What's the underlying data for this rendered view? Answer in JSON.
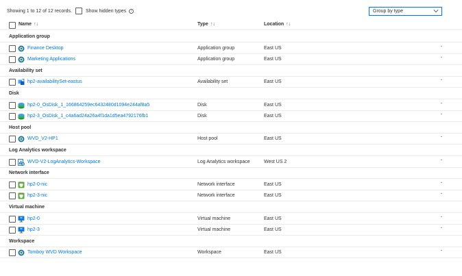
{
  "toolbar": {
    "records_text": "Showing 1 to 12 of 12 records.",
    "show_hidden_label": "Show hidden types",
    "info_glyph": "i",
    "group_by_value": "Group by type"
  },
  "table": {
    "columns": {
      "name": "Name",
      "name_sort": "↑↓",
      "type": "Type",
      "type_sort": "↑↓",
      "location": "Location",
      "location_sort": "↑↓"
    },
    "groups": [
      {
        "label": "Application group",
        "items": [
          {
            "name": "Finance Desktop",
            "type": "Application group",
            "location": "East US",
            "icon": "application-group-icon"
          },
          {
            "name": "Marketing Applications",
            "type": "Application group",
            "location": "East US",
            "icon": "application-group-icon"
          }
        ]
      },
      {
        "label": "Availability set",
        "items": [
          {
            "name": "hp2-availabilitySet-eastus",
            "type": "Availability set",
            "location": "East US",
            "icon": "availability-set-icon"
          }
        ]
      },
      {
        "label": "Disk",
        "items": [
          {
            "name": "hp2-0_OsDisk_1_166864259ec6432480d1094e244af8a5",
            "type": "Disk",
            "location": "East US",
            "icon": "disk-icon"
          },
          {
            "name": "hp2-3_OsDisk_1_c4a6ad24a26a4f1da1d5ea4792176fb1",
            "type": "Disk",
            "location": "East US",
            "icon": "disk-icon"
          }
        ]
      },
      {
        "label": "Host pool",
        "items": [
          {
            "name": "WVD_V2-HP1",
            "type": "Host pool",
            "location": "East US",
            "icon": "host-pool-icon"
          }
        ]
      },
      {
        "label": "Log Analytics workspace",
        "items": [
          {
            "name": "WVD-V2-LogAnalytics-Workspace",
            "type": "Log Analytics workspace",
            "location": "West US 2",
            "icon": "log-analytics-icon"
          }
        ]
      },
      {
        "label": "Network interface",
        "items": [
          {
            "name": "hp2-0-nic",
            "type": "Network interface",
            "location": "East US",
            "icon": "network-interface-icon"
          },
          {
            "name": "hp2-3-nic",
            "type": "Network interface",
            "location": "East US",
            "icon": "network-interface-icon"
          }
        ]
      },
      {
        "label": "Virtual machine",
        "items": [
          {
            "name": "hp2-0",
            "type": "Virtual machine",
            "location": "East US",
            "icon": "virtual-machine-icon"
          },
          {
            "name": "hp2-3",
            "type": "Virtual machine",
            "location": "East US",
            "icon": "virtual-machine-icon"
          }
        ]
      },
      {
        "label": "Workspace",
        "items": [
          {
            "name": "Tomboy WVD Workspace",
            "type": "Workspace",
            "location": "East US",
            "icon": "workspace-icon"
          }
        ]
      }
    ],
    "more_glyph": "·"
  },
  "colors": {
    "link": "#0078d4",
    "text": "#323130",
    "border": "#edebe9",
    "accent": "#0078d4"
  }
}
